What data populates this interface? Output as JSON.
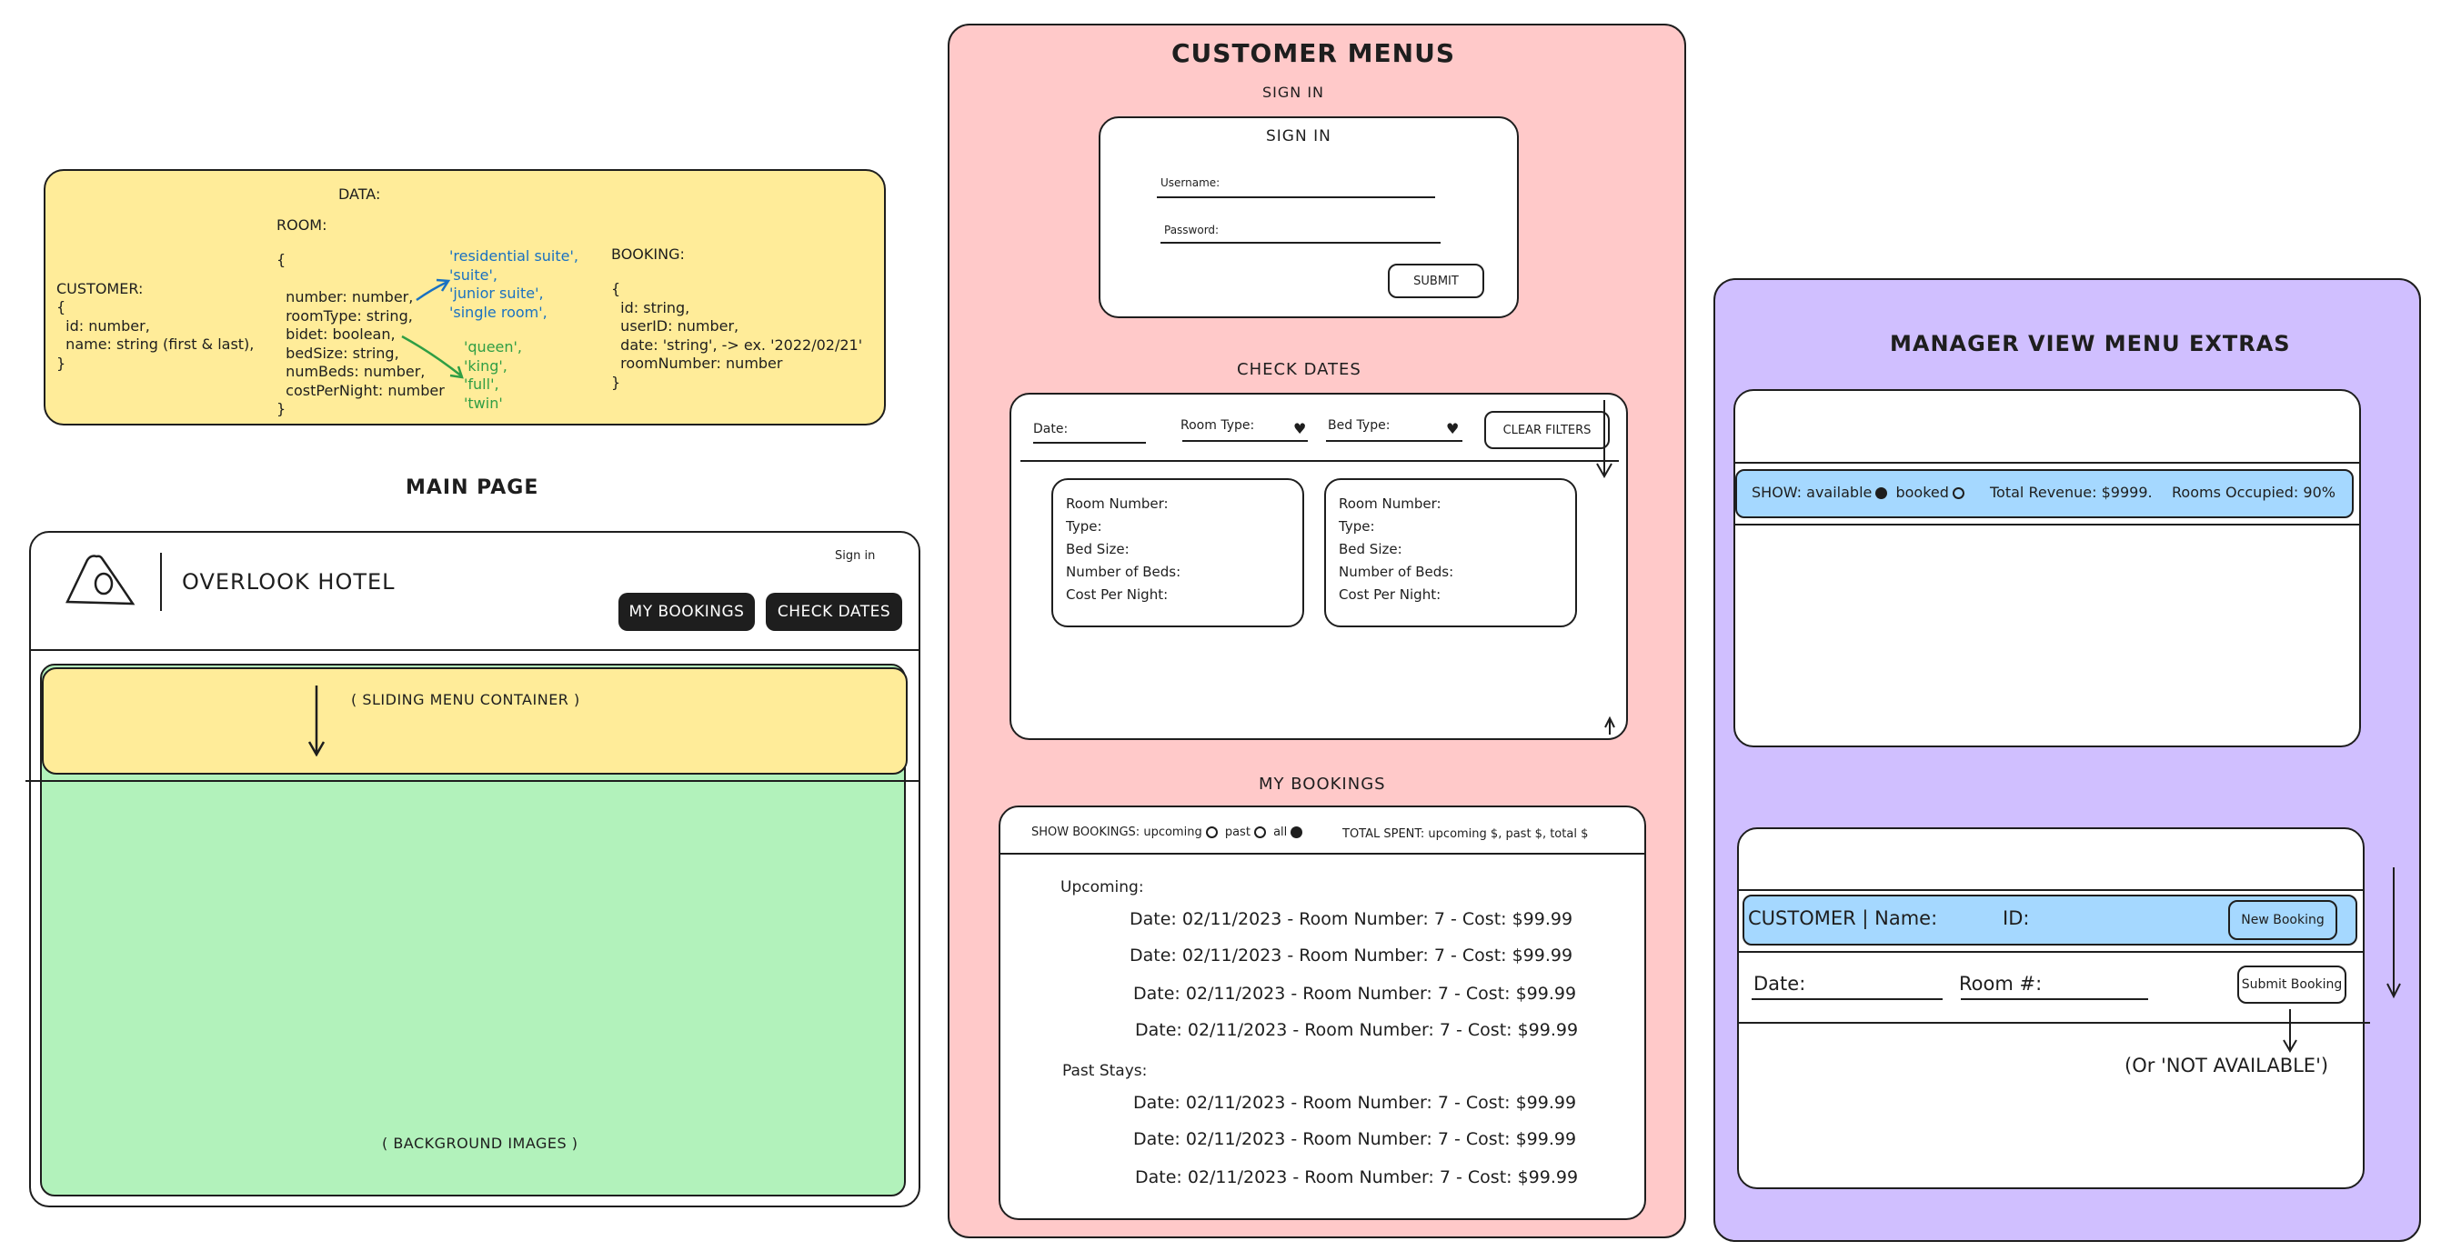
{
  "data_panel": {
    "title": "DATA:",
    "customer_heading": "CUSTOMER:",
    "customer_code": "{\n  id: number,\n  name: string (first & last),\n}",
    "room_heading": "ROOM:",
    "room_code": "{\n\n  number: number,\n  roomType: string,\n  bidet: boolean,\n  bedSize: string,\n  numBeds: number,\n  costPerNight: number\n}",
    "room_types": "'residential suite',\n'suite',\n'junior suite',\n'single room',",
    "bed_sizes": "'queen',\n'king',\n'full',\n'twin'",
    "booking_heading": "BOOKING:",
    "booking_code": "{\n  id: string,\n  userID: number,\n  date: 'string', -> ex. '2022/02/21'\n  roomNumber: number\n}",
    "colors": {
      "fill": "#ffec99",
      "blue_text": "#1971c2",
      "green_text": "#2f9e44"
    }
  },
  "main_page": {
    "label": "MAIN PAGE",
    "hotel_name": "OVERLOOK HOTEL",
    "sign_in_link": "Sign in",
    "my_bookings_button": "MY BOOKINGS",
    "check_dates_button": "CHECK DATES",
    "sliding_menu_label": "( SLIDING MENU CONTAINER )",
    "background_label": "( BACKGROUND IMAGES )",
    "colors": {
      "menu": "#ffec99",
      "background": "#b2f2bb"
    }
  },
  "customer_menus": {
    "title": "CUSTOMER MENUS",
    "color": "#ffc9c9",
    "sign_in": {
      "section_label": "SIGN IN",
      "form_title": "SIGN IN",
      "username_label": "Username:",
      "password_label": "Password:",
      "submit_button": "SUBMIT"
    },
    "check_dates": {
      "section_label": "CHECK DATES",
      "date_label": "Date:",
      "room_type_label": "Room Type:",
      "bed_type_label": "Bed Type:",
      "clear_filters_button": "CLEAR FILTERS",
      "cards": [
        {
          "room_number": "Room Number:",
          "type": "Type:",
          "bed_size": "Bed Size:",
          "num_beds": "Number of Beds:",
          "cost": "Cost Per Night:"
        },
        {
          "room_number": "Room Number:",
          "type": "Type:",
          "bed_size": "Bed Size:",
          "num_beds": "Number of Beds:",
          "cost": "Cost Per Night:"
        }
      ]
    },
    "my_bookings": {
      "section_label": "MY BOOKINGS",
      "show_label": "SHOW BOOKINGS:",
      "opt_upcoming": "upcoming",
      "opt_past": "past",
      "opt_all": "all",
      "total_spent": "TOTAL SPENT: upcoming $, past $, total $",
      "upcoming_heading": "Upcoming:",
      "past_heading": "Past Stays:",
      "upcoming": [
        "Date: 02/11/2023 - Room Number: 7 - Cost: $99.99",
        "Date: 02/11/2023 - Room Number: 7 - Cost: $99.99",
        "Date: 02/11/2023 - Room Number: 7 - Cost: $99.99",
        "Date: 02/11/2023 - Room Number: 7 - Cost: $99.99"
      ],
      "past": [
        "Date: 02/11/2023 - Room Number: 7 - Cost: $99.99",
        "Date: 02/11/2023 - Room Number: 7 - Cost: $99.99",
        "Date: 02/11/2023 - Room Number: 7 - Cost: $99.99"
      ]
    }
  },
  "manager": {
    "title": "MANAGER VIEW MENU EXTRAS",
    "color": "#d0bfff",
    "band_color": "#a5d8ff",
    "show_label": "SHOW:",
    "opt_available": "available",
    "opt_booked": "booked",
    "revenue": "Total Revenue: $9999.",
    "occupied": "Rooms Occupied: 90%",
    "customer_name": "CUSTOMER | Name:",
    "customer_id": "ID:",
    "new_booking_button": "New Booking",
    "date_label": "Date:",
    "room_label": "Room #:",
    "submit_booking_button": "Submit Booking",
    "not_available": "(Or 'NOT AVAILABLE')"
  }
}
